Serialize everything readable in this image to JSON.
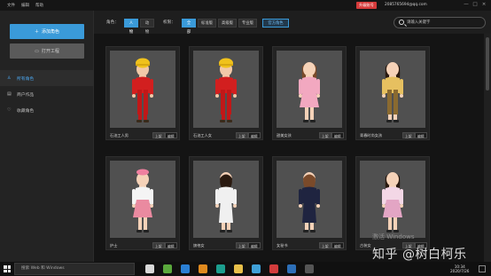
{
  "menubar": {
    "items": [
      "文件",
      "编辑",
      "帮助"
    ],
    "badge": "升级账号",
    "email": "2085765694@qq.com",
    "controls": [
      "—",
      "□",
      "×"
    ]
  },
  "sidebar": {
    "add_button": "添加角色",
    "open_button": "打开工程",
    "nav": [
      {
        "icon": "person-icon",
        "label": "所有角色",
        "active": true
      },
      {
        "icon": "list-icon",
        "label": "商户作品",
        "active": false
      },
      {
        "icon": "heart-icon",
        "label": "收藏角色",
        "active": false
      }
    ]
  },
  "filter": {
    "role_label": "角色：",
    "role_options": [
      "人物",
      "动物"
    ],
    "role_selected": 0,
    "perm_label": "权限：",
    "perm_options": [
      "全部",
      "标准版",
      "高级版",
      "专业版"
    ],
    "perm_selected": 0,
    "custom_button": "官方角色",
    "search_placeholder": "请输入关键字"
  },
  "cards": [
    {
      "name": "石油工人男",
      "outfit": "red",
      "hair": "helmet",
      "skin": "#f2c9a8",
      "btn1": "上架",
      "btn2": "编辑"
    },
    {
      "name": "石油工人女",
      "outfit": "red",
      "hair": "helmet",
      "skin": "#f2c9a8",
      "btn1": "上架",
      "btn2": "编辑"
    },
    {
      "name": "甜美女孩",
      "outfit": "pink-dress",
      "hair": "brown-long",
      "skin": "#f5d2b8",
      "btn1": "上架",
      "btn2": "编辑"
    },
    {
      "name": "青春时尚女孩",
      "outfit": "yellow-top",
      "hair": "black-long",
      "skin": "#f5d2b8",
      "btn1": "上架",
      "btn2": "编辑"
    },
    {
      "name": "护士",
      "outfit": "nurse",
      "hair": "nurse-cap",
      "skin": "#f5d2b8",
      "btn1": "上架",
      "btn2": "编辑"
    },
    {
      "name": "旗袍女",
      "outfit": "qipao-white",
      "hair": "black-bob",
      "skin": "#f5d2b8",
      "btn1": "上架",
      "btn2": "编辑"
    },
    {
      "name": "女秘书",
      "outfit": "navy-dress",
      "hair": "brown-short",
      "skin": "#f5d2b8",
      "btn1": "上架",
      "btn2": "编辑"
    },
    {
      "name": "古装女",
      "outfit": "floral",
      "hair": "black-long",
      "skin": "#f5d2b8",
      "btn1": "上架",
      "btn2": "编辑"
    }
  ],
  "watermark": {
    "activate": "激活 Windows",
    "activate_sub": "转到\"设置\"以激活 Windows。",
    "zhihu": "知乎 @树白柯乐"
  },
  "taskbar": {
    "search_placeholder": "搜索 Web 和 Windows",
    "time": "10:34",
    "date": "2020/7/26",
    "icons": [
      {
        "name": "task-view-icon",
        "color": "#d8d8d8"
      },
      {
        "name": "app-green-icon",
        "color": "#5aa83c"
      },
      {
        "name": "app-blue-icon",
        "color": "#2a7fd4"
      },
      {
        "name": "app-orange-icon",
        "color": "#e08a1e"
      },
      {
        "name": "app-teal-icon",
        "color": "#1c9e8e"
      },
      {
        "name": "folder-icon",
        "color": "#e8c04a"
      },
      {
        "name": "image-app-icon",
        "color": "#3fa0d8"
      },
      {
        "name": "app-red-icon",
        "color": "#d23c3c"
      },
      {
        "name": "am-app-icon",
        "color": "#2d6fb8"
      },
      {
        "name": "app-dark-icon",
        "color": "#555555"
      }
    ]
  },
  "colors": {
    "accent": "#3a9ad9",
    "badge": "#d63b3b"
  }
}
